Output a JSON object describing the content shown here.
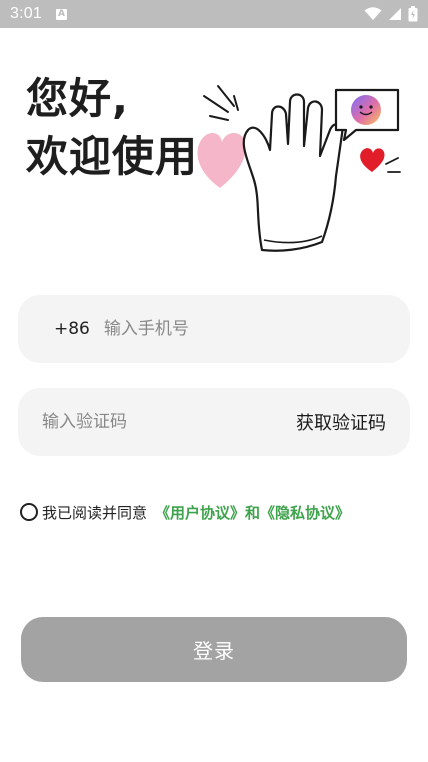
{
  "status_bar": {
    "time": "3:01",
    "notification_badge": "A",
    "icons": [
      "wifi-icon",
      "signal-icon",
      "battery-icon"
    ]
  },
  "greeting": {
    "line1": "您好,",
    "line2": "欢迎使用"
  },
  "hero": {
    "icons": [
      "waving-hand-icon",
      "heart-icon",
      "chat-bubble-icon",
      "smiley-icon"
    ],
    "colors": {
      "pink_heart": "#f4b6c8",
      "red_heart": "#e11d2a"
    }
  },
  "phone": {
    "country_code": "+86",
    "placeholder": "输入手机号",
    "value": ""
  },
  "code": {
    "placeholder": "输入验证码",
    "value": "",
    "get_code_label": "获取验证码"
  },
  "agreement": {
    "checked": false,
    "prefix": "我已阅读并同意",
    "user_agreement": "《用户协议》",
    "and": "和",
    "privacy_policy": "《隐私协议》",
    "link_color": "#3fa34d"
  },
  "login": {
    "label": "登录",
    "color": "#a3a3a3"
  }
}
